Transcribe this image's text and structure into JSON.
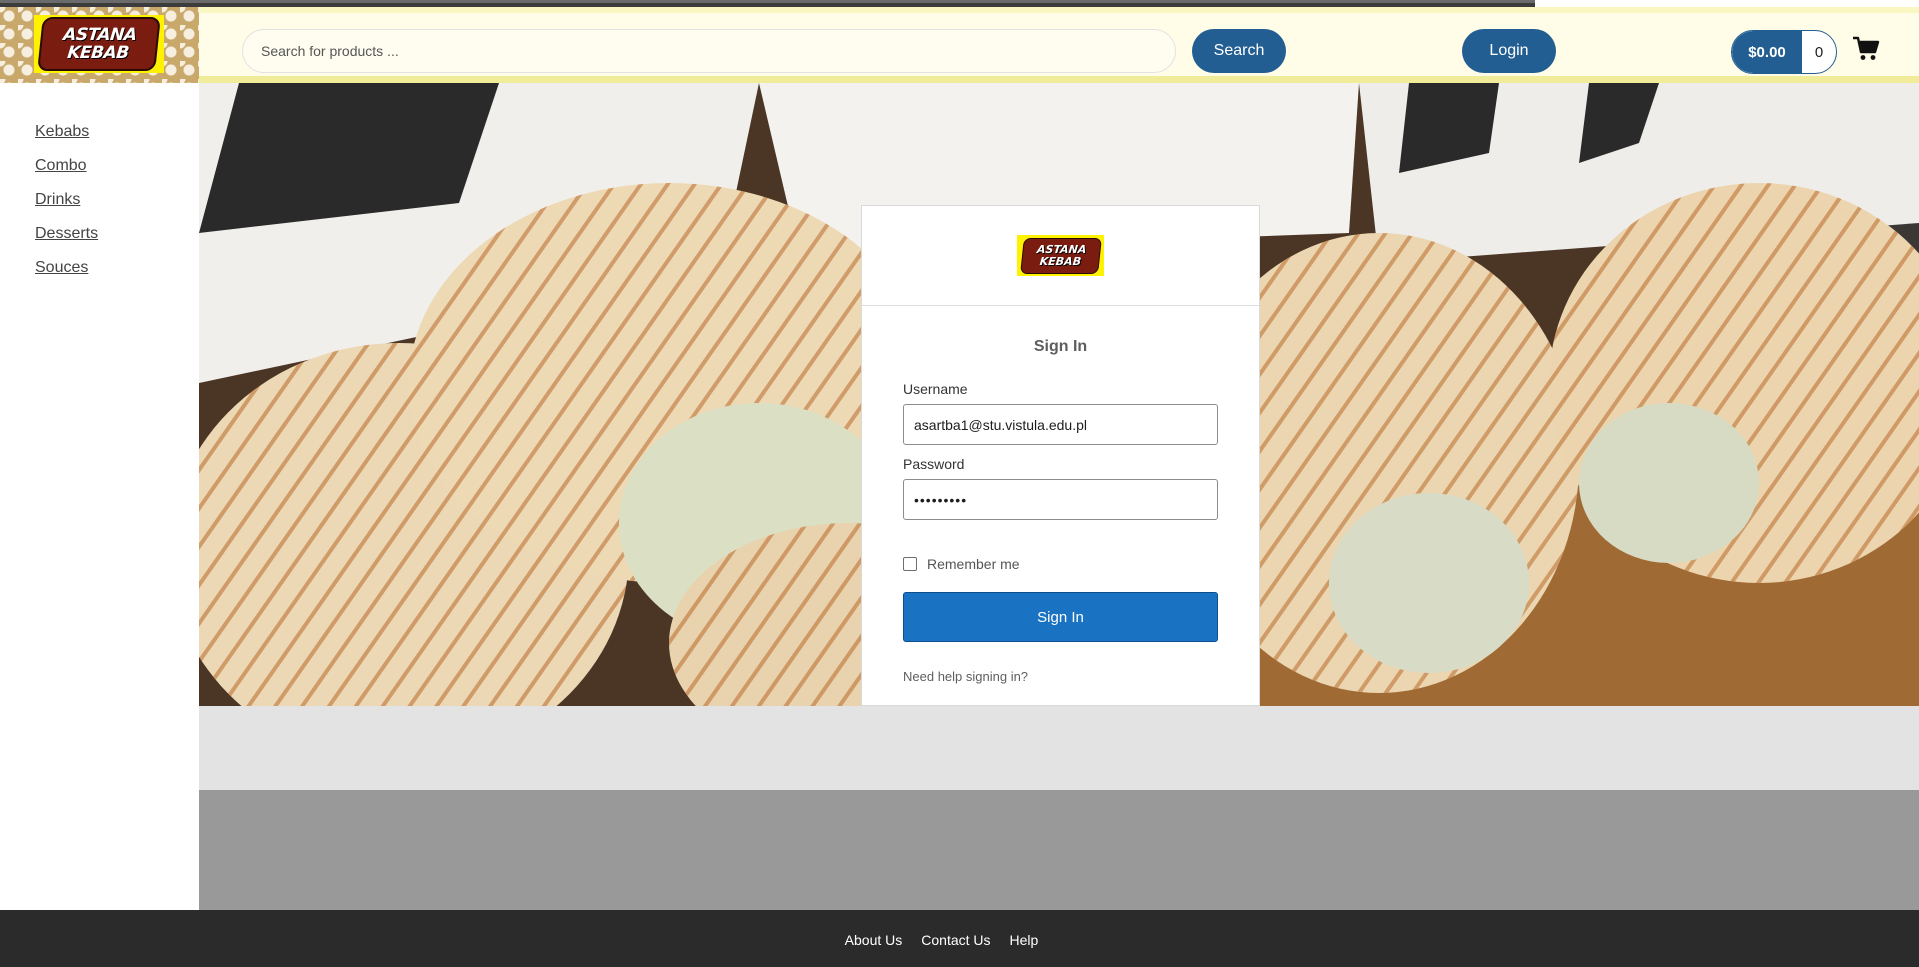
{
  "brand": {
    "logo_line1": "ASTANA",
    "logo_line2": "KEBAB"
  },
  "header": {
    "search_placeholder": "Search for products ...",
    "search_label": "Search",
    "login_label": "Login",
    "cart_total": "$0.00",
    "cart_count": "0"
  },
  "sidebar": {
    "items": [
      {
        "label": "Kebabs"
      },
      {
        "label": "Combo"
      },
      {
        "label": "Drinks"
      },
      {
        "label": "Desserts"
      },
      {
        "label": "Souces"
      }
    ]
  },
  "login": {
    "title": "Sign In",
    "username_label": "Username",
    "username_value": "asartba1@stu.vistula.edu.pl",
    "password_label": "Password",
    "password_value": "•••••••••",
    "remember_label": "Remember me",
    "remember_checked": false,
    "submit_label": "Sign In",
    "help_label": "Need help signing in?"
  },
  "footer": {
    "links": [
      {
        "label": "About Us"
      },
      {
        "label": "Contact Us"
      },
      {
        "label": "Help"
      }
    ]
  },
  "colors": {
    "accent": "#225e91",
    "signin_button": "#1a73c2",
    "footer_bg": "#2b2b2b",
    "header_bg": "#fffde8",
    "logo_yellow": "#fff200"
  }
}
